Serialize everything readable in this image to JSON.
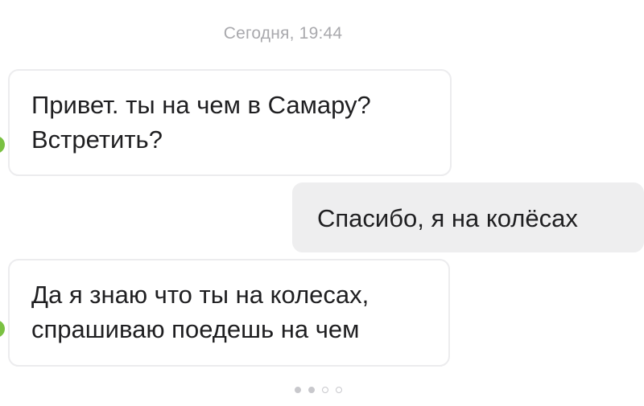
{
  "chat": {
    "timestamp": "Сегодня, 19:44",
    "messages": [
      {
        "direction": "incoming",
        "lines": [
          "Привет. ты на чем в Самару?",
          "Встретить?"
        ]
      },
      {
        "direction": "outgoing",
        "lines": [
          "Спасибо, я на колёсах"
        ]
      },
      {
        "direction": "incoming",
        "lines": [
          "Да я знаю что ты на колесах,",
          "спрашиваю поедешь на чем"
        ]
      }
    ]
  },
  "pager": {
    "total": 4,
    "active_indices": [
      0,
      1
    ]
  },
  "colors": {
    "avatar_accent": "#7ac142",
    "outgoing_bubble": "#eeeeef",
    "timestamp_text": "#a9a9ad"
  },
  "icons": {
    "avatar": "avatar-icon"
  }
}
